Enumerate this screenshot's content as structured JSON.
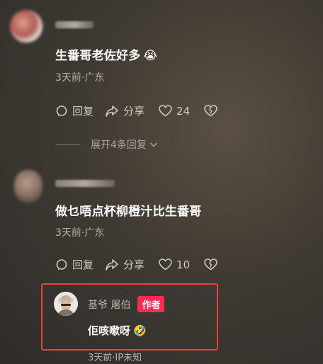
{
  "comment1": {
    "text": "生番哥老佐好多",
    "emoji": "😭",
    "meta": "3天前·广东",
    "reply_label": "回复",
    "share_label": "分享",
    "like_count": "24"
  },
  "expand": {
    "label": "展开4条回复"
  },
  "comment2": {
    "text": "做乜唔点杯柳橙汁比生番哥",
    "meta": "3天前·广东",
    "reply_label": "回复",
    "share_label": "分享",
    "like_count": "10"
  },
  "reply": {
    "author_name": "基爷 屠伯",
    "badge": "作者",
    "text": "佢咳嗽呀",
    "emoji": "🤣",
    "meta": "3天前·IP未知"
  },
  "colors": {
    "highlight_border": "#e3443e",
    "author_badge": "#fe2c55"
  }
}
